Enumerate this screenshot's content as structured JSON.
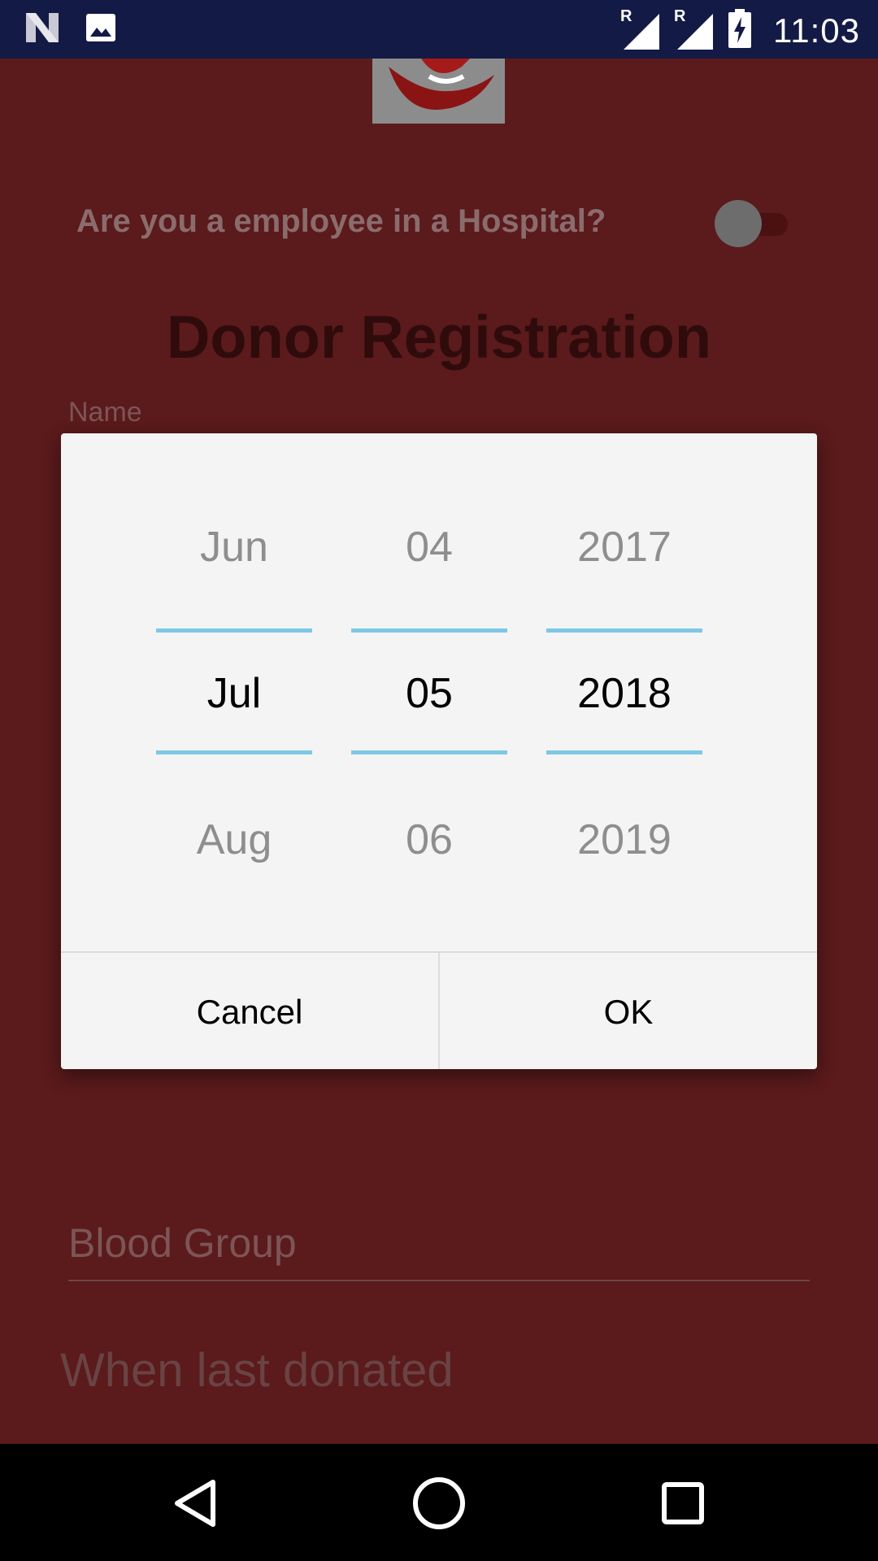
{
  "status_bar": {
    "time": "11:03",
    "roaming_mark_1": "R",
    "roaming_mark_2": "R"
  },
  "app": {
    "question": "Are you a employee in a Hospital?",
    "hospital_toggle_on": false,
    "title": "Donor Registration",
    "name_label": "Name",
    "blood_group_placeholder": "Blood Group",
    "last_donated_label": "When last donated"
  },
  "date_picker": {
    "month": {
      "prev": "Jun",
      "current": "Jul",
      "next": "Aug"
    },
    "day": {
      "prev": "04",
      "current": "05",
      "next": "06"
    },
    "year": {
      "prev": "2017",
      "current": "2018",
      "next": "2019"
    },
    "cancel_label": "Cancel",
    "ok_label": "OK"
  },
  "colors": {
    "status_bar_bg": "#131a45",
    "app_bg_dimmed": "#5b1a1c",
    "picker_divider": "#7ec8e6",
    "dialog_bg": "#f4f4f4"
  }
}
